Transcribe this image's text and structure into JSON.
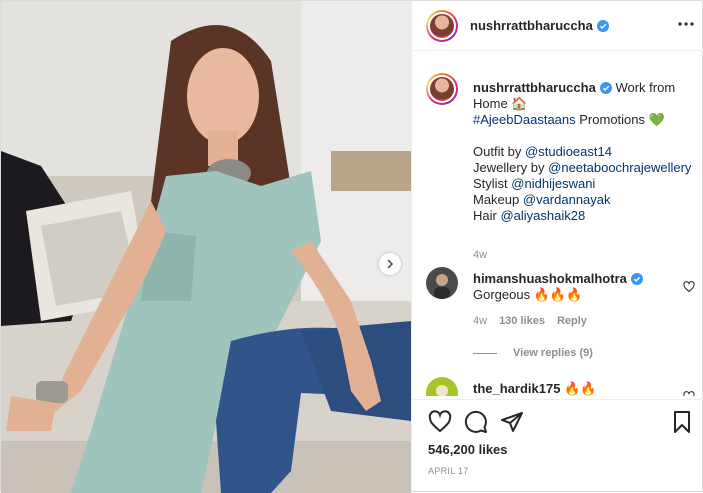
{
  "post": {
    "username": "nushrrattbharuccha",
    "photo_alt_icon": "post-photo",
    "caption_prefix": "Work from Home 🏠",
    "caption_tag": "#AjeebDaastaans",
    "caption_tag_suffix": "Promotions 💚",
    "credits": [
      {
        "label": "Outfit by ",
        "handle": "@studioeast14"
      },
      {
        "label": "Jewellery by ",
        "handle": "@neetaboochrajewellery"
      },
      {
        "label": "Stylist ",
        "handle": "@nidhijeswani"
      },
      {
        "label": "Makeup ",
        "handle": "@vardannayak"
      },
      {
        "label": "Hair ",
        "handle": "@aliyashaik28"
      }
    ],
    "caption_time": "4w"
  },
  "comments": [
    {
      "username": "himanshuashokmalhotra",
      "text": "Gorgeous 🔥🔥🔥",
      "time": "4w",
      "likes": "130 likes",
      "reply_label": "Reply",
      "view_replies": "View replies (9)",
      "verified": true
    },
    {
      "username": "the_hardik175",
      "text": "🔥🔥",
      "verified": false
    }
  ],
  "footer": {
    "likes": "546,200 likes",
    "date": "APRIL 17"
  },
  "colors": {
    "link": "#00376b",
    "verified": "#3897f0",
    "muted": "#8e8e8e"
  }
}
